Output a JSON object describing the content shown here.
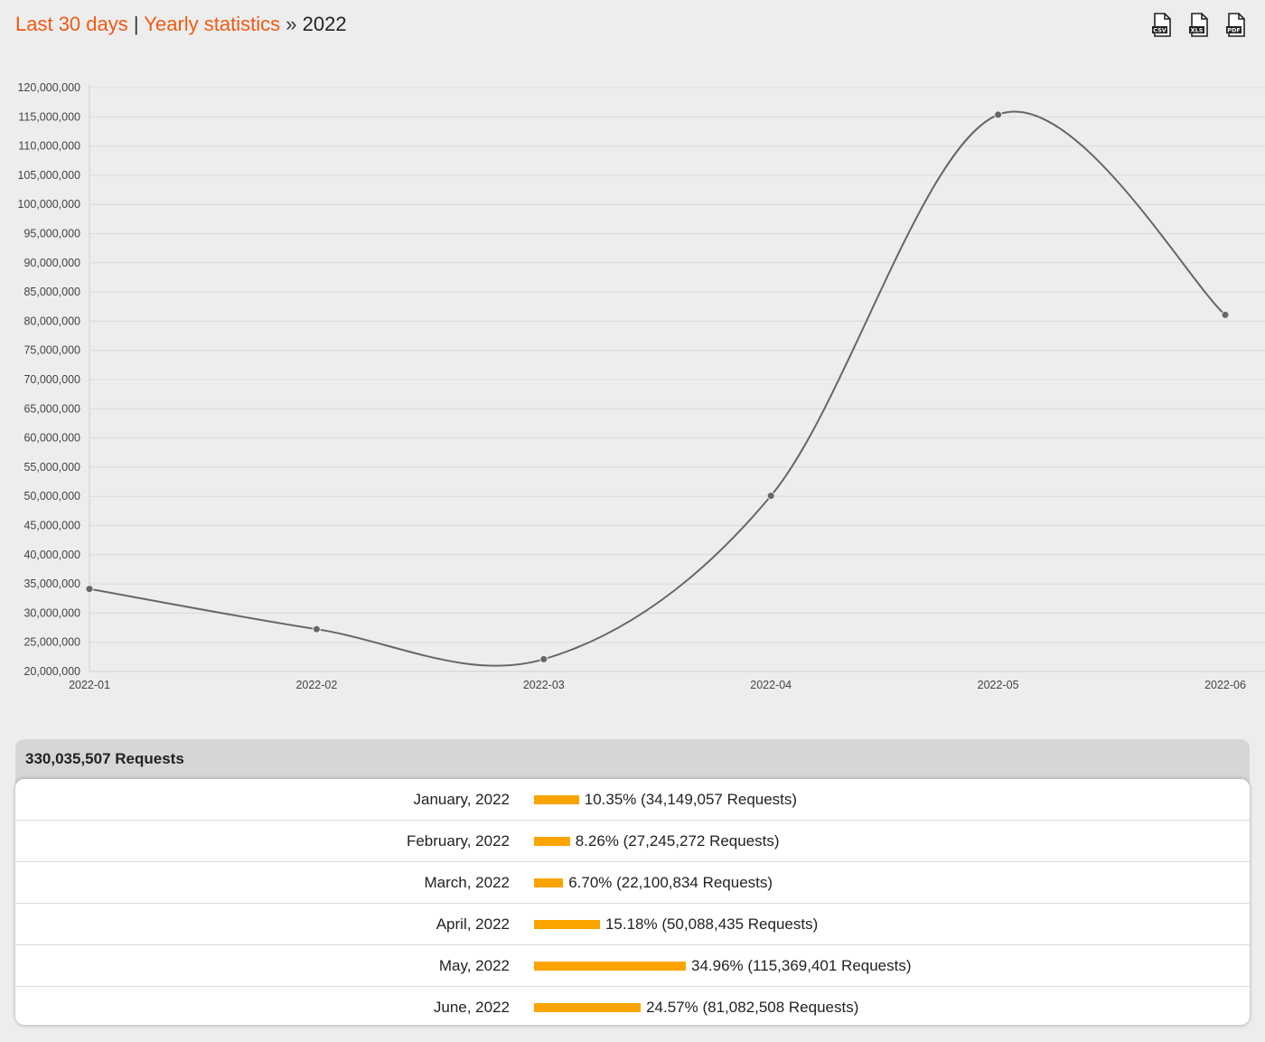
{
  "breadcrumb": {
    "link1": "Last 30 days",
    "separator": "|",
    "link2": "Yearly statistics",
    "arrow": "»",
    "current": "2022"
  },
  "exports": [
    {
      "label": "CSV",
      "icon": "csv-file-icon"
    },
    {
      "label": "XLS",
      "icon": "xls-file-icon"
    },
    {
      "label": "PDF",
      "icon": "pdf-file-icon"
    }
  ],
  "colors": {
    "link": "#f05a14",
    "bar": "#fba400",
    "line": "#666666"
  },
  "chart_data": {
    "type": "line",
    "x": [
      "2022-01",
      "2022-02",
      "2022-03",
      "2022-04",
      "2022-05",
      "2022-06"
    ],
    "series": [
      {
        "values": [
          34149057,
          27245272,
          22100834,
          50088435,
          115369401,
          81082508
        ]
      }
    ],
    "ylim": [
      20000000,
      120000000
    ],
    "ytick_step": 5000000,
    "grid": true,
    "smooth": true
  },
  "summary": {
    "total": "330,035,507 Requests"
  },
  "rows": [
    {
      "label": "January, 2022",
      "percent": 10.35,
      "value": "10.35% (34,149,057 Requests)"
    },
    {
      "label": "February, 2022",
      "percent": 8.26,
      "value": "8.26% (27,245,272 Requests)"
    },
    {
      "label": "March, 2022",
      "percent": 6.7,
      "value": "6.70% (22,100,834 Requests)"
    },
    {
      "label": "April, 2022",
      "percent": 15.18,
      "value": "15.18% (50,088,435 Requests)"
    },
    {
      "label": "May, 2022",
      "percent": 34.96,
      "value": "34.96% (115,369,401 Requests)"
    },
    {
      "label": "June, 2022",
      "percent": 24.57,
      "value": "24.57% (81,082,508 Requests)"
    }
  ]
}
